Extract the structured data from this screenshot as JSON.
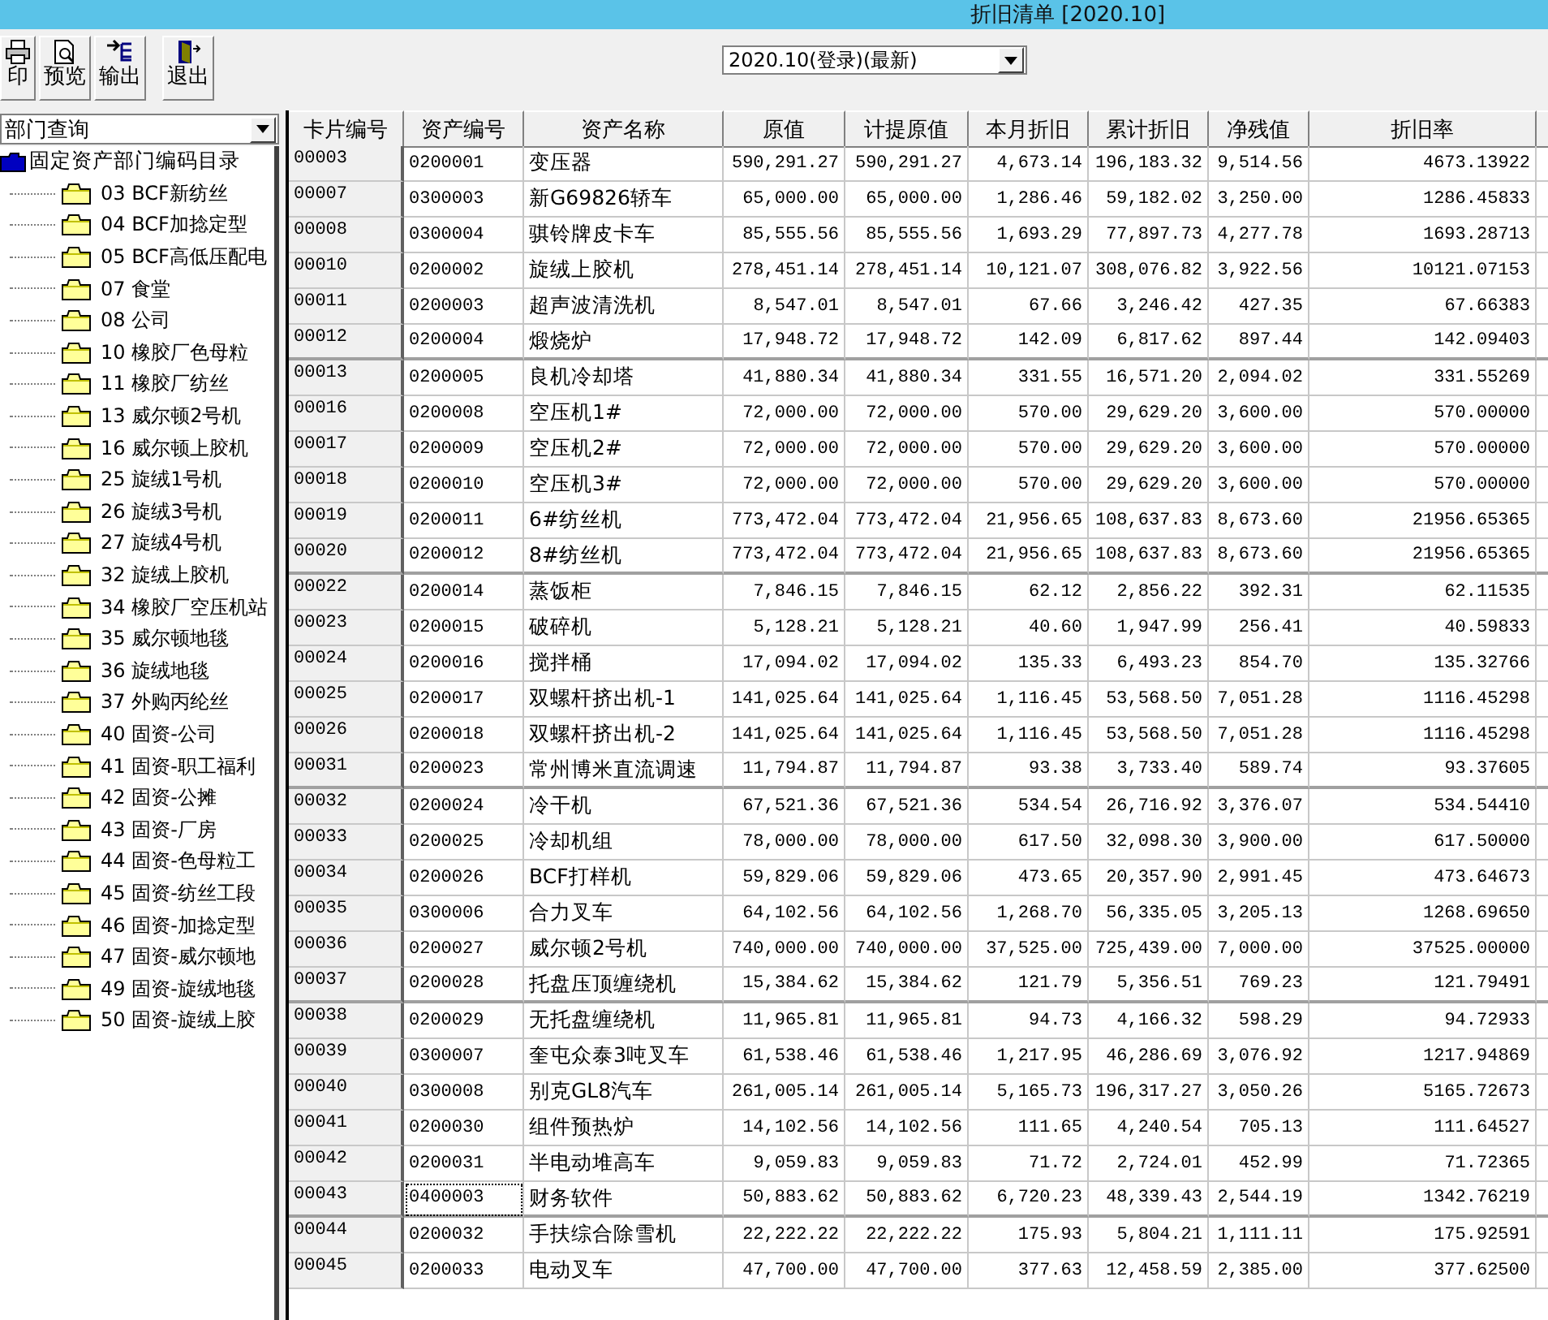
{
  "window": {
    "title": "折旧清单 [2020.10]"
  },
  "toolbar": [
    {
      "kind": "print",
      "label": "印"
    },
    {
      "kind": "preview",
      "label": "预览"
    },
    {
      "kind": "export",
      "label": "输出"
    },
    {
      "kind": "exit",
      "label": "退出"
    }
  ],
  "period_select": {
    "value": "2020.10(登录)(最新)"
  },
  "query_select": {
    "value": "部门查询"
  },
  "tree": {
    "label": "固定资产部门编码目录",
    "children": [
      {
        "label": "03 BCF新纺丝"
      },
      {
        "label": "04 BCF加捻定型"
      },
      {
        "label": "05 BCF高低压配电"
      },
      {
        "label": "07 食堂"
      },
      {
        "label": "08 公司"
      },
      {
        "label": "10 橡胶厂色母粒"
      },
      {
        "label": "11 橡胶厂纺丝"
      },
      {
        "label": "13 威尔顿2号机"
      },
      {
        "label": "16 威尔顿上胶机"
      },
      {
        "label": "25 旋绒1号机"
      },
      {
        "label": "26 旋绒3号机"
      },
      {
        "label": "27 旋绒4号机"
      },
      {
        "label": "32 旋绒上胶机"
      },
      {
        "label": "34 橡胶厂空压机站"
      },
      {
        "label": "35 威尔顿地毯"
      },
      {
        "label": "36 旋绒地毯"
      },
      {
        "label": "37 外购丙纶丝"
      },
      {
        "label": "40 固资-公司"
      },
      {
        "label": "41 固资-职工福利"
      },
      {
        "label": "42 固资-公摊"
      },
      {
        "label": "43 固资-厂房"
      },
      {
        "label": "44 固资-色母粒工"
      },
      {
        "label": "45 固资-纺丝工段"
      },
      {
        "label": "46 固资-加捻定型"
      },
      {
        "label": "47 固资-威尔顿地"
      },
      {
        "label": "49 固资-旋绒地毯"
      },
      {
        "label": "50 固资-旋绒上胶"
      }
    ]
  },
  "table": {
    "columns": [
      "卡片编号",
      "资产编号",
      "资产名称",
      "原值",
      "计提原值",
      "本月折旧",
      "累计折旧",
      "净残值",
      "折旧率"
    ],
    "rows": [
      {
        "cells": [
          "00003",
          "0200001",
          "变压器",
          "590,291.27",
          "590,291.27",
          "4,673.14",
          "196,183.32",
          "9,514.56",
          "4673.13922"
        ],
        "focused": false
      },
      {
        "cells": [
          "00007",
          "0300003",
          "新G69826轿车",
          "65,000.00",
          "65,000.00",
          "1,286.46",
          "59,182.02",
          "3,250.00",
          "1286.45833"
        ],
        "focused": false
      },
      {
        "cells": [
          "00008",
          "0300004",
          "骐铃牌皮卡车",
          "85,555.56",
          "85,555.56",
          "1,693.29",
          "77,897.73",
          "4,277.78",
          "1693.28713"
        ],
        "focused": false
      },
      {
        "cells": [
          "00010",
          "0200002",
          "旋绒上胶机",
          "278,451.14",
          "278,451.14",
          "10,121.07",
          "308,076.82",
          "3,922.56",
          "10121.07153"
        ],
        "focused": false
      },
      {
        "cells": [
          "00011",
          "0200003",
          "超声波清洗机",
          "8,547.01",
          "8,547.01",
          "67.66",
          "3,246.42",
          "427.35",
          "67.66383"
        ],
        "focused": false
      },
      {
        "cells": [
          "00012",
          "0200004",
          "煅烧炉",
          "17,948.72",
          "17,948.72",
          "142.09",
          "6,817.62",
          "897.44",
          "142.09403"
        ],
        "focused": false
      },
      {
        "cells": [
          "00013",
          "0200005",
          "良机冷却塔",
          "41,880.34",
          "41,880.34",
          "331.55",
          "16,571.20",
          "2,094.02",
          "331.55269"
        ],
        "focused": false
      },
      {
        "cells": [
          "00016",
          "0200008",
          "空压机1#",
          "72,000.00",
          "72,000.00",
          "570.00",
          "29,629.20",
          "3,600.00",
          "570.00000"
        ],
        "focused": false
      },
      {
        "cells": [
          "00017",
          "0200009",
          "空压机2#",
          "72,000.00",
          "72,000.00",
          "570.00",
          "29,629.20",
          "3,600.00",
          "570.00000"
        ],
        "focused": false
      },
      {
        "cells": [
          "00018",
          "0200010",
          "空压机3#",
          "72,000.00",
          "72,000.00",
          "570.00",
          "29,629.20",
          "3,600.00",
          "570.00000"
        ],
        "focused": false
      },
      {
        "cells": [
          "00019",
          "0200011",
          "6#纺丝机",
          "773,472.04",
          "773,472.04",
          "21,956.65",
          "108,637.83",
          "8,673.60",
          "21956.65365"
        ],
        "focused": false
      },
      {
        "cells": [
          "00020",
          "0200012",
          "8#纺丝机",
          "773,472.04",
          "773,472.04",
          "21,956.65",
          "108,637.83",
          "8,673.60",
          "21956.65365"
        ],
        "focused": false
      },
      {
        "cells": [
          "00022",
          "0200014",
          "蒸饭柜",
          "7,846.15",
          "7,846.15",
          "62.12",
          "2,856.22",
          "392.31",
          "62.11535"
        ],
        "focused": false
      },
      {
        "cells": [
          "00023",
          "0200015",
          "破碎机",
          "5,128.21",
          "5,128.21",
          "40.60",
          "1,947.99",
          "256.41",
          "40.59833"
        ],
        "focused": false
      },
      {
        "cells": [
          "00024",
          "0200016",
          "搅拌桶",
          "17,094.02",
          "17,094.02",
          "135.33",
          "6,493.23",
          "854.70",
          "135.32766"
        ],
        "focused": false
      },
      {
        "cells": [
          "00025",
          "0200017",
          "双螺杆挤出机-1",
          "141,025.64",
          "141,025.64",
          "1,116.45",
          "53,568.50",
          "7,051.28",
          "1116.45298"
        ],
        "focused": false
      },
      {
        "cells": [
          "00026",
          "0200018",
          "双螺杆挤出机-2",
          "141,025.64",
          "141,025.64",
          "1,116.45",
          "53,568.50",
          "7,051.28",
          "1116.45298"
        ],
        "focused": false
      },
      {
        "cells": [
          "00031",
          "0200023",
          "常州博米直流调速",
          "11,794.87",
          "11,794.87",
          "93.38",
          "3,733.40",
          "589.74",
          "93.37605"
        ],
        "focused": false
      },
      {
        "cells": [
          "00032",
          "0200024",
          "冷干机",
          "67,521.36",
          "67,521.36",
          "534.54",
          "26,716.92",
          "3,376.07",
          "534.54410"
        ],
        "focused": false
      },
      {
        "cells": [
          "00033",
          "0200025",
          "冷却机组",
          "78,000.00",
          "78,000.00",
          "617.50",
          "32,098.30",
          "3,900.00",
          "617.50000"
        ],
        "focused": false
      },
      {
        "cells": [
          "00034",
          "0200026",
          "BCF打样机",
          "59,829.06",
          "59,829.06",
          "473.65",
          "20,357.90",
          "2,991.45",
          "473.64673"
        ],
        "focused": false
      },
      {
        "cells": [
          "00035",
          "0300006",
          "合力叉车",
          "64,102.56",
          "64,102.56",
          "1,268.70",
          "56,335.05",
          "3,205.13",
          "1268.69650"
        ],
        "focused": false
      },
      {
        "cells": [
          "00036",
          "0200027",
          "威尔顿2号机",
          "740,000.00",
          "740,000.00",
          "37,525.00",
          "725,439.00",
          "7,000.00",
          "37525.00000"
        ],
        "focused": false
      },
      {
        "cells": [
          "00037",
          "0200028",
          "托盘压顶缠绕机",
          "15,384.62",
          "15,384.62",
          "121.79",
          "5,356.51",
          "769.23",
          "121.79491"
        ],
        "focused": false
      },
      {
        "cells": [
          "00038",
          "0200029",
          "无托盘缠绕机",
          "11,965.81",
          "11,965.81",
          "94.73",
          "4,166.32",
          "598.29",
          "94.72933"
        ],
        "focused": false
      },
      {
        "cells": [
          "00039",
          "0300007",
          "奎屯众泰3吨叉车",
          "61,538.46",
          "61,538.46",
          "1,217.95",
          "46,286.69",
          "3,076.92",
          "1217.94869"
        ],
        "focused": false
      },
      {
        "cells": [
          "00040",
          "0300008",
          "别克GL8汽车",
          "261,005.14",
          "261,005.14",
          "5,165.73",
          "196,317.27",
          "3,050.26",
          "5165.72673"
        ],
        "focused": false
      },
      {
        "cells": [
          "00041",
          "0200030",
          "组件预热炉",
          "14,102.56",
          "14,102.56",
          "111.65",
          "4,240.54",
          "705.13",
          "111.64527"
        ],
        "focused": false
      },
      {
        "cells": [
          "00042",
          "0200031",
          "半电动堆高车",
          "9,059.83",
          "9,059.83",
          "71.72",
          "2,724.01",
          "452.99",
          "71.72365"
        ],
        "focused": false
      },
      {
        "cells": [
          "00043",
          "0400003",
          "财务软件",
          "50,883.62",
          "50,883.62",
          "6,720.23",
          "48,339.43",
          "2,544.19",
          "1342.76219"
        ],
        "focused": true
      },
      {
        "cells": [
          "00044",
          "0200032",
          "手扶综合除雪机",
          "22,222.22",
          "22,222.22",
          "175.93",
          "5,804.21",
          "1,111.11",
          "175.92591"
        ],
        "focused": false
      },
      {
        "cells": [
          "00045",
          "0200033",
          "电动叉车",
          "47,700.00",
          "47,700.00",
          "377.63",
          "12,458.59",
          "2,385.00",
          "377.62500"
        ],
        "focused": false
      }
    ]
  }
}
